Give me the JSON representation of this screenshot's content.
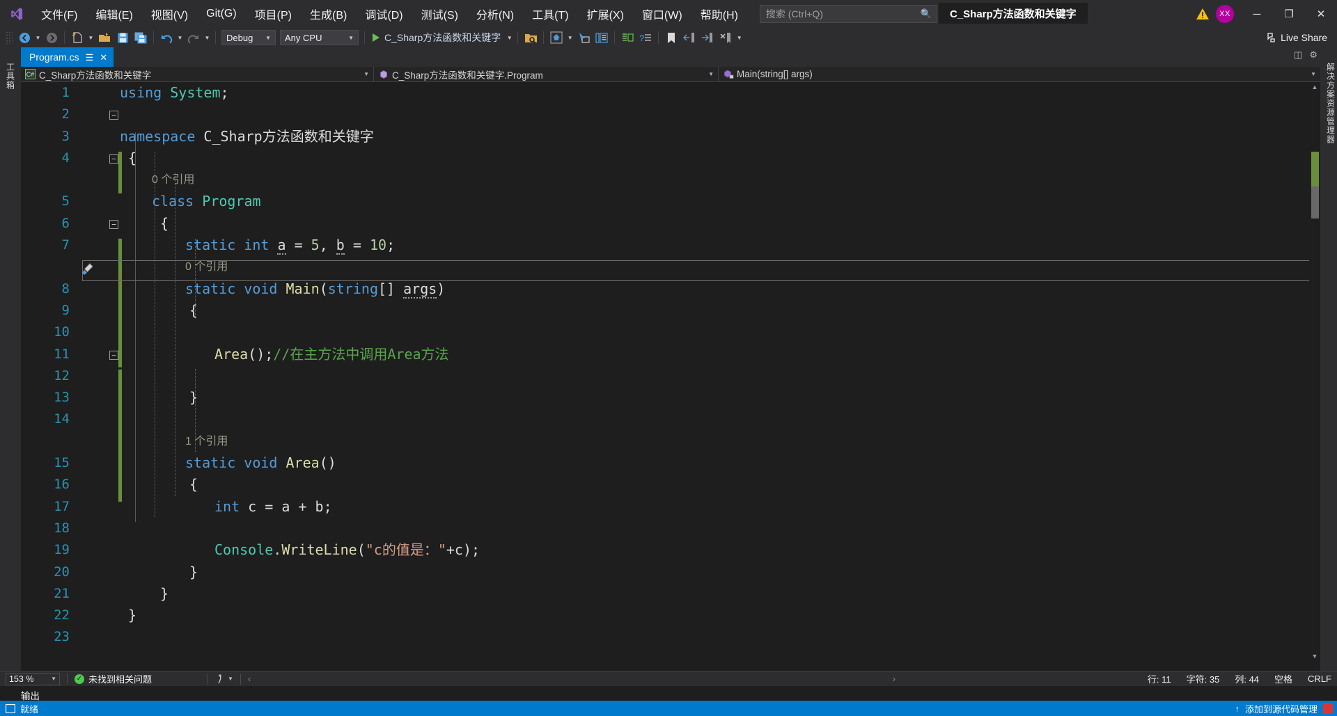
{
  "app": {
    "logo_icon": "visual-studio-logo",
    "window_title": "C_Sharp方法函数和关键字",
    "warning_icon": "warning-triangle-icon",
    "account_initials": "XX",
    "minimize_icon": "─",
    "maximize_icon": "❐",
    "close_icon": "✕"
  },
  "menu": {
    "items": [
      {
        "label": "文件(F)",
        "name": "menu-file"
      },
      {
        "label": "编辑(E)",
        "name": "menu-edit"
      },
      {
        "label": "视图(V)",
        "name": "menu-view"
      },
      {
        "label": "Git(G)",
        "name": "menu-git"
      },
      {
        "label": "项目(P)",
        "name": "menu-project"
      },
      {
        "label": "生成(B)",
        "name": "menu-build"
      },
      {
        "label": "调试(D)",
        "name": "menu-debug"
      },
      {
        "label": "测试(S)",
        "name": "menu-test"
      },
      {
        "label": "分析(N)",
        "name": "menu-analyze"
      },
      {
        "label": "工具(T)",
        "name": "menu-tools"
      },
      {
        "label": "扩展(X)",
        "name": "menu-extensions"
      },
      {
        "label": "窗口(W)",
        "name": "menu-window"
      },
      {
        "label": "帮助(H)",
        "name": "menu-help"
      }
    ]
  },
  "search": {
    "placeholder": "搜索 (Ctrl+Q)",
    "value": "",
    "icon": "search-icon"
  },
  "toolbar": {
    "configuration": "Debug",
    "platform": "Any CPU",
    "start_project": "C_Sharp方法函数和关键字",
    "live_share": "Live Share",
    "icons": [
      "navigate-back-icon",
      "navigate-forward-icon",
      "new-item-icon",
      "open-file-icon",
      "save-icon",
      "save-all-icon",
      "undo-icon",
      "redo-icon",
      "solution-explorer-search-icon",
      "home-icon",
      "select-element-icon",
      "toggle-panel-icon",
      "comment-icon",
      "quick-find-icon",
      "bookmark-icon",
      "prev-bookmark-icon",
      "next-bookmark-icon",
      "clear-bookmarks-icon"
    ]
  },
  "left_rail": {
    "label": "工具箱"
  },
  "right_rail": {
    "label": "解决方案资源管理器"
  },
  "tabs": [
    {
      "title": "Program.cs",
      "pin_icon": "pin-icon",
      "close_icon": "close-icon",
      "active": true
    }
  ],
  "breadcrumb": {
    "project": "C_Sharp方法函数和关键字",
    "project_icon": "csharp-file-icon",
    "class": "C_Sharp方法函数和关键字.Program",
    "class_icon": "class-icon",
    "member": "Main(string[] args)",
    "member_icon": "method-icon",
    "dropdown_icon": "chevron-down-icon"
  },
  "editor": {
    "language": "csharp",
    "current_line_number": 11,
    "quick_action_icon": "screwdriver-quick-action-icon",
    "lines": [
      {
        "n": 1,
        "text": "using System;"
      },
      {
        "n": 2,
        "text": ""
      },
      {
        "n": 3,
        "text": "namespace C_Sharp方法函数和关键字"
      },
      {
        "n": 4,
        "text": "{"
      },
      {
        "n": "",
        "text": "0 个引用",
        "codelens": true
      },
      {
        "n": 5,
        "text": "    class Program"
      },
      {
        "n": 6,
        "text": "    {"
      },
      {
        "n": 7,
        "text": "        static int a = 5, b = 10;"
      },
      {
        "n": "",
        "text": "0 个引用",
        "codelens": true
      },
      {
        "n": 8,
        "text": "        static void Main(string[] args)"
      },
      {
        "n": 9,
        "text": "        {"
      },
      {
        "n": 10,
        "text": ""
      },
      {
        "n": 11,
        "text": "            Area();//在主方法中调用Area方法"
      },
      {
        "n": 12,
        "text": ""
      },
      {
        "n": 13,
        "text": "        }"
      },
      {
        "n": 14,
        "text": ""
      },
      {
        "n": "",
        "text": "1 个引用",
        "codelens": true
      },
      {
        "n": 15,
        "text": "        static void Area()"
      },
      {
        "n": 16,
        "text": "        {"
      },
      {
        "n": 17,
        "text": "            int c = a + b;"
      },
      {
        "n": 18,
        "text": ""
      },
      {
        "n": 19,
        "text": "            Console.WriteLine(\"c的值是：\"+c);"
      },
      {
        "n": 20,
        "text": "        }"
      },
      {
        "n": 21,
        "text": "    }"
      },
      {
        "n": 22,
        "text": "}"
      },
      {
        "n": 23,
        "text": ""
      }
    ],
    "codelens_refs": {
      "class_program": "0 个引用",
      "main": "0 个引用",
      "area": "1 个引用"
    }
  },
  "status": {
    "zoom": "153 %",
    "problems": "未找到相关问题",
    "problems_icon": "check-circle-icon",
    "line_label": "行: 11",
    "char_label": "字符: 35",
    "col_label": "列: 44",
    "spaces_label": "空格",
    "eol_label": "CRLF"
  },
  "output_panel": {
    "title": "输出"
  },
  "bottom_bar": {
    "ready": "就绪",
    "ready_icon": "ready-icon",
    "notification": "添加到源代码管理",
    "upload_icon": "↑",
    "flag_icon": "notification-flag-icon"
  },
  "colors": {
    "accent": "#007acc",
    "titlebar": "#2d2d30",
    "editor_bg": "#1e1e1e",
    "keyword": "#569cd6",
    "type": "#4ec9b0",
    "method": "#dcdcaa",
    "string": "#d69d85",
    "number": "#b5cea8",
    "comment": "#57a64a",
    "linenum": "#2b91af",
    "avatar": "#b4009e"
  }
}
